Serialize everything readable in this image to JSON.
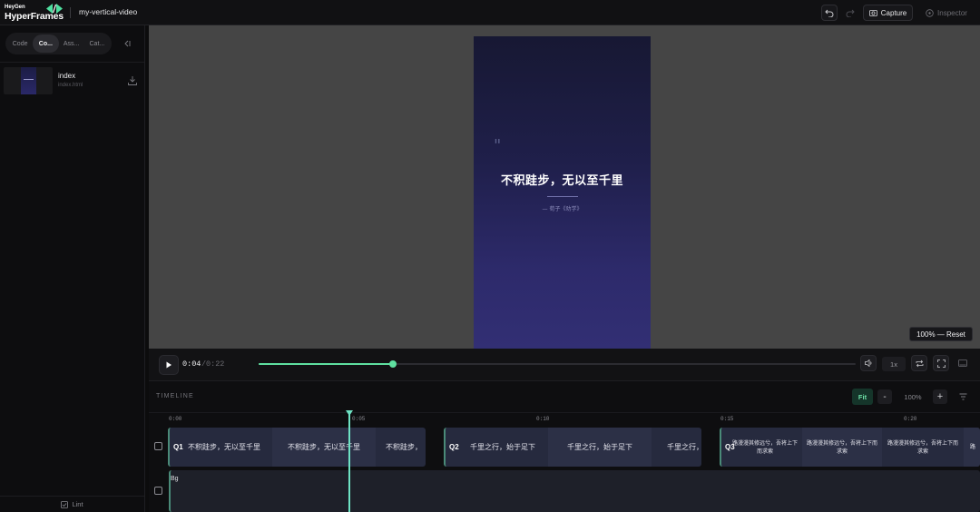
{
  "brand": {
    "small": "HeyGen",
    "big": "HyperFrames"
  },
  "project": {
    "name": "my-vertical-video"
  },
  "toolbar": {
    "capture_label": "Capture",
    "inspector_label": "Inspector"
  },
  "sidebar": {
    "tabs": [
      {
        "label": "Code",
        "active": false
      },
      {
        "label": "Co...",
        "active": true
      },
      {
        "label": "Ass...",
        "active": false
      },
      {
        "label": "Cat...",
        "active": false
      }
    ],
    "compositions": [
      {
        "title": "index",
        "file": "index.html"
      }
    ],
    "lint_label": "Lint"
  },
  "preview": {
    "quote_mark": "\"",
    "quote_text": "不积跬步，无以至千里",
    "quote_author": "— 荀子《劝学》",
    "zoom_reset_label": "100% — Reset"
  },
  "player": {
    "current_time": "0:04",
    "separator": "/",
    "total_time": "0:22",
    "progress": 0.225,
    "speed": "1x"
  },
  "timeline": {
    "title": "TIMELINE",
    "fit_label": "Fit",
    "zoom_minus": "-",
    "zoom_level": "100%",
    "zoom_plus": "+",
    "ticks": [
      "0:00",
      "0:05",
      "0:10",
      "0:15",
      "0:20"
    ],
    "clips": {
      "q1": {
        "label": "Q1",
        "segments": [
          "不积跬步，无以至千里",
          "不积跬步，无以至千里",
          "不积跬步，"
        ]
      },
      "q2": {
        "label": "Q2",
        "segments": [
          "千里之行，始于足下",
          "千里之行，始于足下",
          "千里之行，"
        ]
      },
      "q3": {
        "label": "Q3",
        "segments": [
          "路漫漫其修远兮，吾将上下而求索",
          "路漫漫其修远兮，吾将上下而求索",
          "路漫漫其修远兮，吾将上下而求索",
          "路"
        ]
      },
      "bg": {
        "label": "Bg"
      }
    },
    "playhead_time": "0:04"
  },
  "colors": {
    "accent": "#5fe0a0",
    "canvas_top": "#171833",
    "canvas_bottom": "#322f74"
  }
}
